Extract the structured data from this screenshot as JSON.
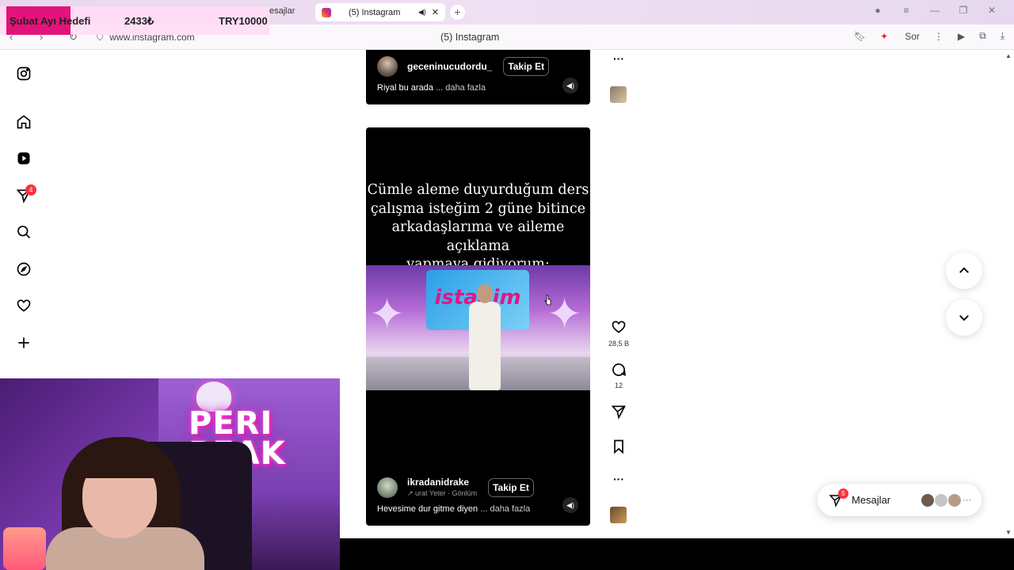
{
  "browser": {
    "prev_tab_label": "esajlar",
    "active_tab_title": "(5) Instagram",
    "url": "www.instagram.com",
    "page_title": "(5) Instagram",
    "ask_label": "Sor"
  },
  "goal_overlay": {
    "label": "Şubat Ayı Hedefi",
    "current": "2433₺",
    "target": "TRY10000",
    "progress": 0.2433,
    "fill_color": "#e2147b"
  },
  "sidebar": {
    "items": [
      {
        "name": "instagram-logo-icon"
      },
      {
        "name": "home-icon"
      },
      {
        "name": "reels-icon"
      },
      {
        "name": "messages-icon",
        "badge": "4"
      },
      {
        "name": "search-icon"
      },
      {
        "name": "explore-icon"
      },
      {
        "name": "notifications-icon"
      },
      {
        "name": "create-icon"
      }
    ]
  },
  "reel_top": {
    "username": "geceninucudordu_",
    "follow_label": "Takip Et",
    "caption": "Riyal bu arada",
    "more_label": "... daha fazla"
  },
  "reel_main": {
    "overlay_text": [
      "Cümle aleme duyurduğum ders",
      "çalışma isteğim 2 güne bitince",
      "arkadaşlarıma ve aileme açıklama",
      "yapmaya gidiyorum;"
    ],
    "video_logo": "istaSim",
    "username": "ikradanidrake",
    "follow_label": "Takip Et",
    "audio": "urat Yeter · Gönlüm",
    "caption": "Hevesime dur gitme diyen",
    "more_label": "... daha fazla"
  },
  "actions": {
    "likes": "28,5 B",
    "comments": "12"
  },
  "messages": {
    "label": "Mesajlar",
    "badge": "5",
    "more": "···"
  },
  "webcam": {
    "logo_line1": "PERI",
    "logo_line2": "PEAK"
  },
  "colors": {
    "badge": "#ff3040",
    "tab_bar": "#e9d7ee"
  }
}
